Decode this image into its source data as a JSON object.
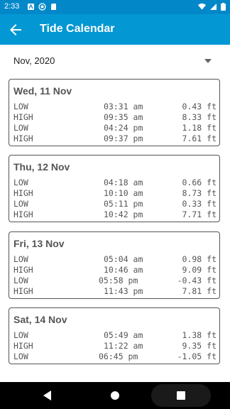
{
  "status_bar": {
    "time": "2:33",
    "left_icons": [
      "notification-a-icon",
      "notification-b-icon",
      "sd-card-icon"
    ],
    "right_icons": [
      "wifi-icon",
      "signal-icon",
      "battery-icon"
    ]
  },
  "app_bar": {
    "title": "Tide Calendar",
    "back_icon": "arrow-left-icon"
  },
  "month_selector": {
    "selected": "Nov, 2020"
  },
  "days": [
    {
      "title": "Wed, 11 Nov",
      "tides": [
        {
          "type": "LOW",
          "time": "03:31 am",
          "height": "0.43 ft"
        },
        {
          "type": "HIGH",
          "time": "09:35 am",
          "height": "8.33 ft"
        },
        {
          "type": "LOW",
          "time": "04:24 pm",
          "height": "1.18 ft"
        },
        {
          "type": "HIGH",
          "time": "09:37 pm",
          "height": "7.61 ft"
        }
      ]
    },
    {
      "title": "Thu, 12 Nov",
      "tides": [
        {
          "type": "LOW",
          "time": "04:18 am",
          "height": "0.66 ft"
        },
        {
          "type": "HIGH",
          "time": "10:10 am",
          "height": "8.73 ft"
        },
        {
          "type": "LOW",
          "time": "05:11 pm",
          "height": "0.33 ft"
        },
        {
          "type": "HIGH",
          "time": "10:42 pm",
          "height": "7.71 ft"
        }
      ]
    },
    {
      "title": "Fri, 13 Nov",
      "tides": [
        {
          "type": "LOW",
          "time": "05:04 am",
          "height": "0.98 ft"
        },
        {
          "type": "HIGH",
          "time": "10:46 am",
          "height": "9.09 ft"
        },
        {
          "type": "LOW",
          "time": "05:58 pm",
          "height": "-0.43 ft"
        },
        {
          "type": "HIGH",
          "time": "11:43 pm",
          "height": "7.81 ft"
        }
      ]
    },
    {
      "title": "Sat, 14 Nov",
      "tides": [
        {
          "type": "LOW",
          "time": "05:49 am",
          "height": "1.38 ft"
        },
        {
          "type": "HIGH",
          "time": "11:22 am",
          "height": "9.35 ft"
        },
        {
          "type": "LOW",
          "time": "06:45 pm",
          "height": "-1.05 ft"
        }
      ]
    }
  ],
  "nav_bar": {
    "buttons": [
      "back-triangle-icon",
      "home-circle-icon",
      "recents-square-icon"
    ]
  },
  "colors": {
    "status_bar": "#0288c9",
    "app_bar": "#0397d3",
    "card_border": "#555555",
    "text": "#555555"
  }
}
